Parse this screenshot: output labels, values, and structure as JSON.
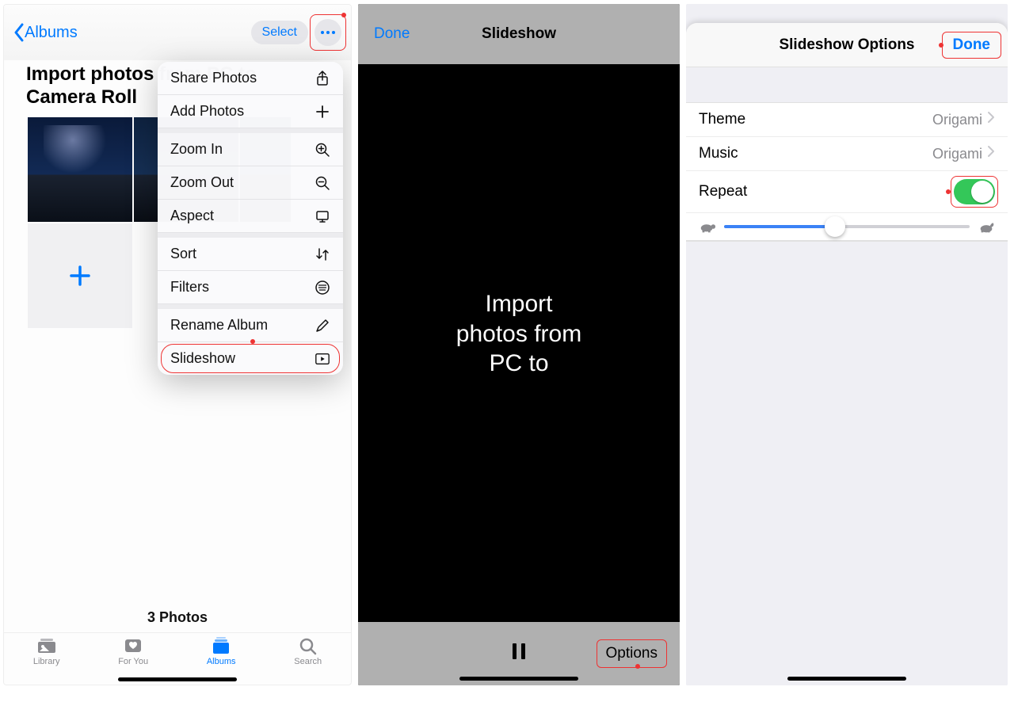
{
  "panel1": {
    "back_label": "Albums",
    "select_label": "Select",
    "album_title": "Import photos from PC to Camera Roll",
    "photo_count": "3 Photos",
    "menu": {
      "share": "Share Photos",
      "add": "Add Photos",
      "zoom_in": "Zoom In",
      "zoom_out": "Zoom Out",
      "aspect": "Aspect",
      "sort": "Sort",
      "filters": "Filters",
      "rename": "Rename Album",
      "slideshow": "Slideshow"
    },
    "tabs": {
      "library": "Library",
      "for_you": "For You",
      "albums": "Albums",
      "search": "Search"
    }
  },
  "panel2": {
    "done": "Done",
    "title": "Slideshow",
    "slide_text_line1": "Import",
    "slide_text_line2": "photos from",
    "slide_text_line3": "PC to",
    "options": "Options"
  },
  "panel3": {
    "title": "Slideshow Options",
    "done": "Done",
    "theme_label": "Theme",
    "theme_value": "Origami",
    "music_label": "Music",
    "music_value": "Origami",
    "repeat_label": "Repeat",
    "repeat_on": true,
    "speed_value": 0.45
  }
}
